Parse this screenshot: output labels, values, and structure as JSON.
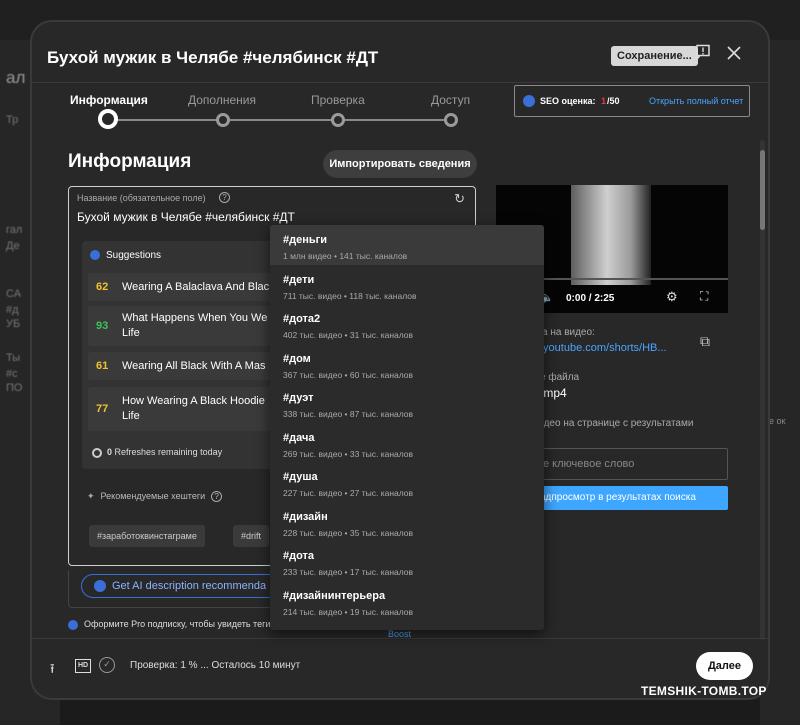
{
  "dialog": {
    "title": "Бухой мужик в Челябе #челябинск #ДТ",
    "save_status": "Сохранение...",
    "feedback_icon": "feedback-icon",
    "close_icon": "close-icon"
  },
  "steps": [
    {
      "label": "Информация",
      "active": true
    },
    {
      "label": "Дополнения",
      "active": false
    },
    {
      "label": "Проверка",
      "active": false
    },
    {
      "label": "Доступ",
      "active": false
    }
  ],
  "seo": {
    "label": "SEO оценка:",
    "score": "1",
    "max": "/50",
    "link": "Открыть полный отчет"
  },
  "section": {
    "title": "Информация",
    "import_button": "Импортировать сведения"
  },
  "title_field": {
    "label": "Название (обязательное поле)",
    "value": "Бухой мужик в Челябе #челябинск #ДТ"
  },
  "suggestions": {
    "heading": "Suggestions",
    "items": [
      {
        "score": "62",
        "color": "#f2c230",
        "text": "Wearing A Balaclava And Blac"
      },
      {
        "score": "93",
        "color": "#3cc35b",
        "text": "What Happens When You We\nLife"
      },
      {
        "score": "61",
        "color": "#f2c230",
        "text": "Wearing All Black With A Mas"
      },
      {
        "score": "77",
        "color": "#f2c230",
        "text": "How Wearing A Black Hoodie\nLife"
      }
    ],
    "refreshes_count": "0",
    "refreshes_text": "Refreshes remaining today"
  },
  "recommended_tags": {
    "label": "Рекомендуемые хештеги",
    "chips": [
      "#заработоквинстаграме",
      "#drift"
    ]
  },
  "ai_button": "Get AI description recommenda",
  "pro_note": "Оформите Pro подписку, чтобы увидеть теги",
  "boost": "Boost",
  "video": {
    "time": "0:00 / 2:25"
  },
  "right": {
    "link_label": "а на видео:",
    "link_value": "/youtube.com/shorts/HB...",
    "file_label": "е файла",
    "file_value": ".mp4",
    "search_note": "идео на странице с результатами\nа",
    "keyword_placeholder": "е ключевое слово",
    "preview_button": "адпросмотр в результатах поиска"
  },
  "footer": {
    "status": "Проверка: 1 % ... Осталось 10 минут",
    "next_button": "Далее",
    "hd_label": "HD"
  },
  "hashtags": [
    {
      "tag": "#деньги",
      "stats": "1 млн видео • 141 тыс. каналов"
    },
    {
      "tag": "#дети",
      "stats": "711 тыс. видео • 118 тыс. каналов"
    },
    {
      "tag": "#дота2",
      "stats": "402 тыс. видео • 31 тыс. каналов"
    },
    {
      "tag": "#дом",
      "stats": "367 тыс. видео • 60 тыс. каналов"
    },
    {
      "tag": "#дуэт",
      "stats": "338 тыс. видео • 87 тыс. каналов"
    },
    {
      "tag": "#дача",
      "stats": "269 тыс. видео • 33 тыс. каналов"
    },
    {
      "tag": "#душа",
      "stats": "227 тыс. видео • 27 тыс. каналов"
    },
    {
      "tag": "#дизайн",
      "stats": "228 тыс. видео • 35 тыс. каналов"
    },
    {
      "tag": "#дота",
      "stats": "233 тыс. видео • 17 тыс. каналов"
    },
    {
      "tag": "#дизайнинтерьера",
      "stats": "214 тыс. видео • 19 тыс. каналов"
    }
  ],
  "background": {
    "left_texts": [
      "ал",
      "Тр",
      "гал",
      "Де",
      "СА",
      "#д",
      "УБ",
      "Ты",
      "#с",
      "ПО"
    ],
    "right_text": "не ок"
  },
  "watermark": "TEMSHIK-TOMB.TOP"
}
